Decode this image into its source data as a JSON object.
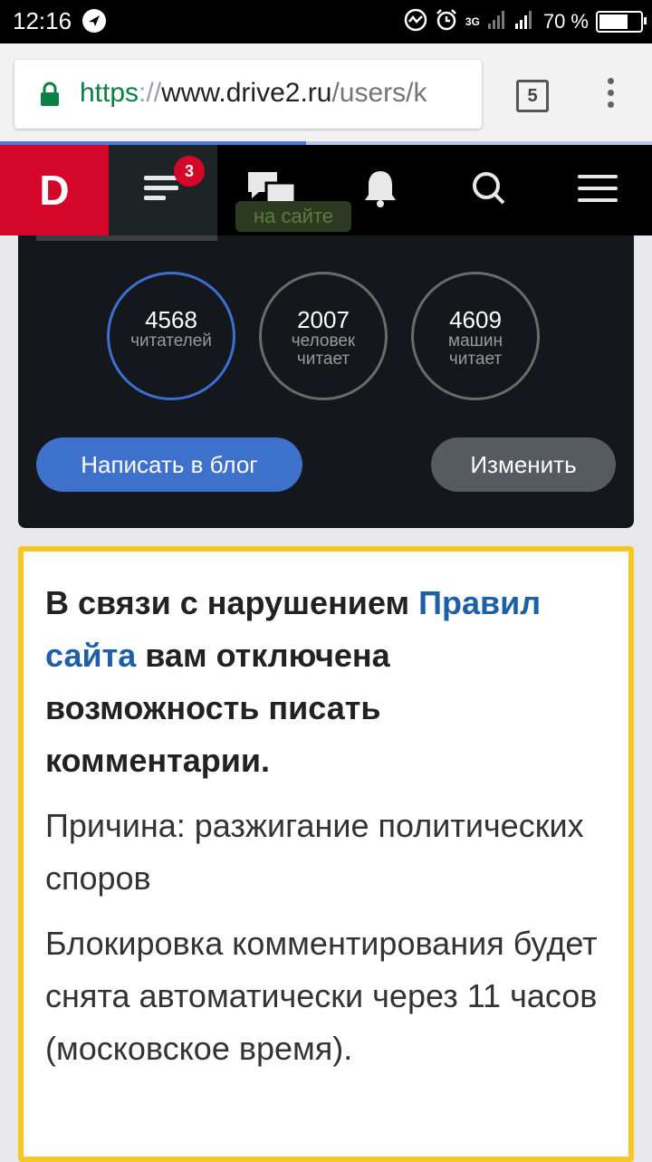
{
  "status_bar": {
    "time": "12:16",
    "network": "3G",
    "battery_percent": "70 %"
  },
  "browser": {
    "url_scheme": "https",
    "url_slashes": "://",
    "url_host": "www.drive2.ru",
    "url_path": "/users/k",
    "tabs_count": "5",
    "load_progress": 0.47
  },
  "site_nav": {
    "logo": "D",
    "feed_badge": "3",
    "icons": [
      "feed-icon",
      "messages-icon",
      "bell-icon",
      "search-icon",
      "menu-icon"
    ],
    "online_status": "на сайте"
  },
  "profile": {
    "stats": [
      {
        "value": "4568",
        "label": "читателей"
      },
      {
        "value": "2007",
        "label": "человек читает"
      },
      {
        "value": "4609",
        "label": "машин читает"
      }
    ],
    "write_blog_button": "Написать в блог",
    "edit_button": "Изменить"
  },
  "notice": {
    "heading_before": "В связи с нарушением ",
    "rules_link": "Правил сайта",
    "heading_after": " вам отключена возможность писать комментарии.",
    "reason": "Причина: разжигание политических споров",
    "unblock_info": "Блокировка комментирования будет снята автоматически через 11 часов (московское время)."
  },
  "colors": {
    "logo_red": "#d4062a",
    "link_blue": "#1f5fa8",
    "notice_border": "#f6c826",
    "primary_button": "#3d71cc"
  }
}
